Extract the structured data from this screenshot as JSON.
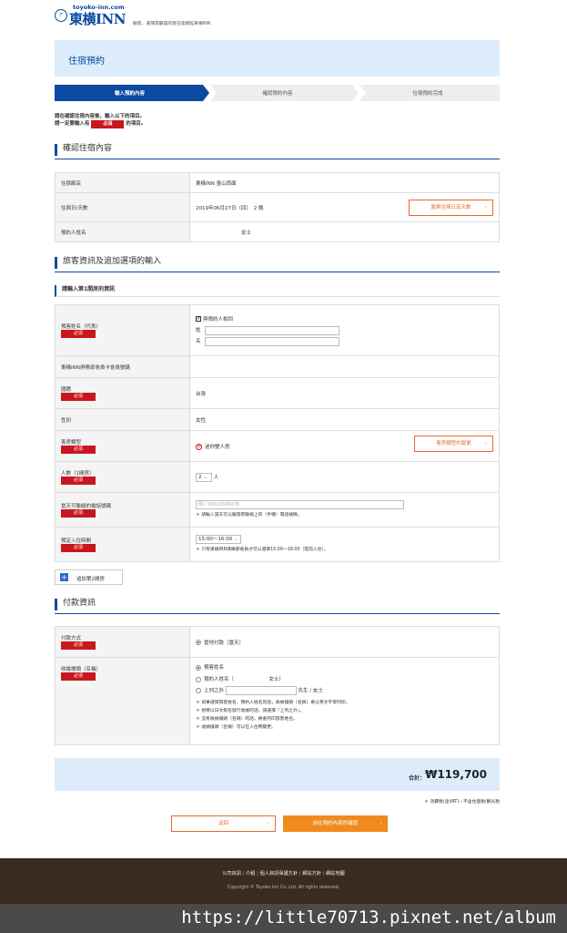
{
  "header": {
    "site_url": "toyoko-inn.com",
    "logo_mark": "東横",
    "logo_text": "東横INN",
    "tagline": "顧客，選擇旅籠是的我在達鋼館東横INN"
  },
  "page_title": "住宿預約",
  "steps": [
    "輸入預約內容",
    "確認預約內容",
    "住宿預約完成"
  ],
  "instructions": {
    "line1": "請在確認住宿內容後，輸入以下的項目。",
    "line2_prefix": "請一定要輸入有",
    "line2_suffix": "的項目。"
  },
  "required_label": "必須",
  "section_confirm": {
    "title": "確認住宿內容",
    "hotel_label": "住宿飯店",
    "hotel_value": "東橫INN 釜山西面",
    "dates_label": "住宿日/天數",
    "dates_value": "2019年06月27日（四）　2 晚",
    "change_dates_button": "變更住宿日及天數",
    "booker_label": "預約人姓名",
    "booker_value": "女士"
  },
  "section_guest": {
    "title": "旅客資訊及追加選項的輸入",
    "room_subtitle": "請輸入第1間房的資訊",
    "guest_name_label": "預客姓名（代表）",
    "same_as_booker": "與預約人相同",
    "surname_label": "姓",
    "given_name_label": "名",
    "member_label": "東橫INN俱樂部會員卡會員號碼",
    "nationality_label": "國籍",
    "nationality_value": "台灣",
    "gender_label": "性別",
    "gender_value": "女性",
    "room_type_label": "客房類型",
    "room_type_value": "迷你雙人房",
    "change_room_button": "客房類型的變更",
    "people_label": "人數（1間房）",
    "people_value": "2",
    "people_unit": "人",
    "phone_label": "當天可聯絡的電話號碼",
    "phone_placeholder": "例）09012345678",
    "phone_note": "＊ 請輸入當天可以跟旅客聯絡上的（手機）電話號碼。",
    "checkin_label": "預定入住時間",
    "checkin_value": "15:00～16:00",
    "checkin_note": "＊ 只有東橫INN俱樂部會員才可以選擇15:00～16:00（提前入住）。",
    "add_room_button": "追加第2間房"
  },
  "section_payment": {
    "title": "付款資訊",
    "method_label": "付款方式",
    "method_value": "當地付款（當天）",
    "receipt_label": "收據擡頭（名稱）",
    "receipt_opt1": "預客姓名",
    "receipt_opt2": "預約人姓名（　　　　　　　女士）",
    "receipt_opt3": "上列之外",
    "receipt_opt3_suffix": "先生 / 女士",
    "notes": [
      "＊ 如果選擇旅客姓名、預約人姓名的話，收據擡頭（名稱）會以英文字母列印。",
      "＊ 想要以日文假名發行收據的話，請選擇『上列之外』。",
      "＊ 沒有收據擡頭（名稱）的話，將會列印旅客姓名。",
      "＊ 收據擡頭（名稱）可以在入住時變更。"
    ]
  },
  "total": {
    "label": "合計：",
    "amount": "₩119,700",
    "note": "＊ 消費稅(含VAT)・不含住宿稅/觀光稅"
  },
  "buttons": {
    "back": "返回",
    "confirm": "前往預約內容的確認"
  },
  "footer": {
    "links": [
      "公司資訊",
      "介紹",
      "個人資訊保護方針",
      "網站方針",
      "網站地圖"
    ],
    "copyright": "Copyright © Toyoko Inn Co.,Ltd. All rights reserved."
  },
  "watermark": "https://little70713.pixnet.net/album",
  "colors": {
    "brand_blue": "#0b4aa0",
    "required_red": "#c8171e",
    "orange": "#f08a1c",
    "light_blue_bg": "#ddecfb",
    "footer_brown": "#3a2a20"
  }
}
